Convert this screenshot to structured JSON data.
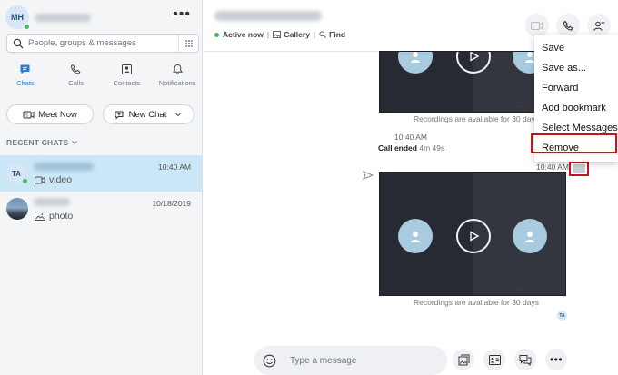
{
  "profile": {
    "initials": "MH"
  },
  "search": {
    "placeholder": "People, groups & messages"
  },
  "nav": {
    "tabs": [
      {
        "label": "Chats"
      },
      {
        "label": "Calls"
      },
      {
        "label": "Contacts"
      },
      {
        "label": "Notifications"
      }
    ]
  },
  "actions": {
    "meet_now": "Meet Now",
    "new_chat": "New Chat"
  },
  "recent": {
    "heading": "RECENT CHATS"
  },
  "chats": [
    {
      "initials": "TA",
      "time": "10:40 AM",
      "preview": "video",
      "preview_icon": "video-icon"
    },
    {
      "time": "10/18/2019",
      "preview": "photo",
      "preview_icon": "photo-icon"
    }
  ],
  "header": {
    "status": "Active now",
    "gallery": "Gallery",
    "find": "Find",
    "separator": "|"
  },
  "conversation": {
    "rec_note_1": "Recordings are available for 30 days",
    "time_1": "10:40 AM",
    "call_ended": "Call ended",
    "call_duration": "4m 49s",
    "time_2": "10:40 AM",
    "rec_note_2": "Recordings are available for 30 days",
    "badge_initials": "TA"
  },
  "context_menu": {
    "items": [
      "Save",
      "Save as...",
      "Forward",
      "Add bookmark",
      "Select Messages",
      "Remove"
    ]
  },
  "composer": {
    "placeholder": "Type a message"
  },
  "colors": {
    "accent": "#2b7cd3",
    "online": "#49b85c",
    "highlight": "#c8141c",
    "selected_chat": "#cbe6f6"
  }
}
